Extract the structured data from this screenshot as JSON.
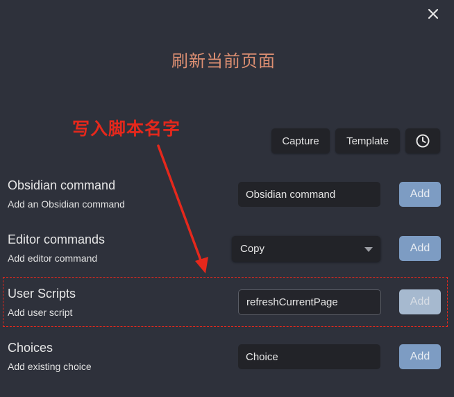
{
  "modal": {
    "title": "刷新当前页面",
    "annotation": "写入脚本名字",
    "close_icon": "close-icon"
  },
  "toolbar": {
    "capture_label": "Capture",
    "template_label": "Template",
    "history_icon": "clock-icon"
  },
  "rows": {
    "obsidian": {
      "title": "Obsidian command",
      "description": "Add an Obsidian command",
      "placeholder": "Obsidian command",
      "add_label": "Add"
    },
    "editor": {
      "title": "Editor commands",
      "description": "Add editor command",
      "selected": "Copy",
      "add_label": "Add"
    },
    "scripts": {
      "title": "User Scripts",
      "description": "Add user script",
      "value": "refreshCurrentPage",
      "add_label": "Add"
    },
    "choices": {
      "title": "Choices",
      "description": "Add existing choice",
      "placeholder": "Choice",
      "add_label": "Add"
    }
  },
  "colors": {
    "accent": "#7d9cc3",
    "title": "#dd8f72",
    "annotation": "#e5281c",
    "background": "#2e313b"
  }
}
